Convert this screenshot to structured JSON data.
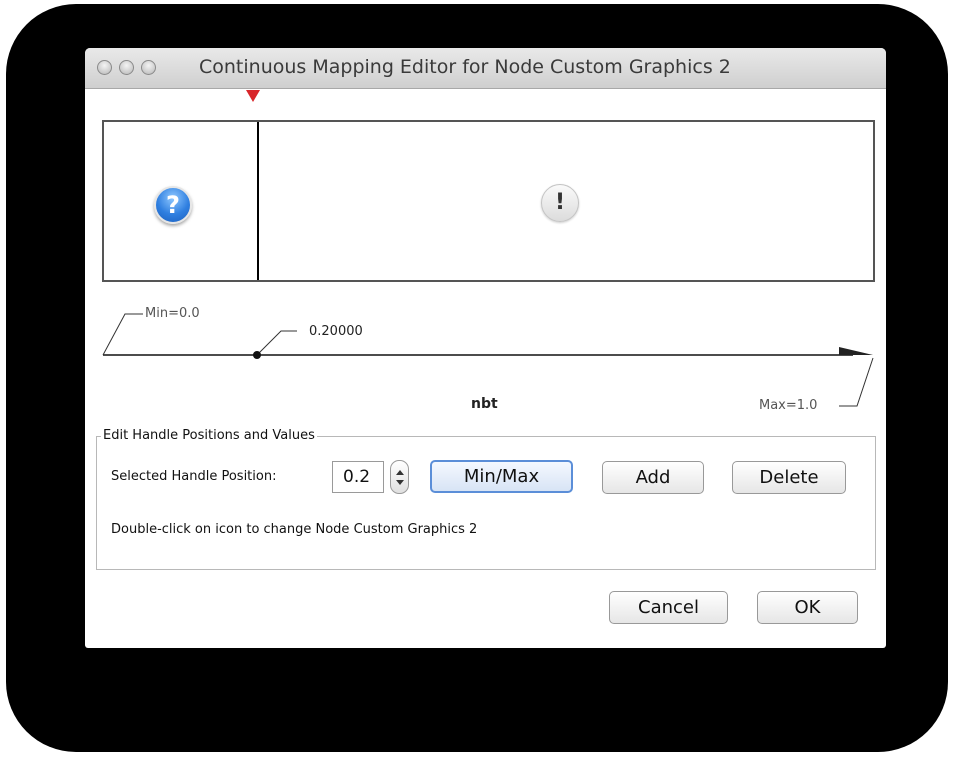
{
  "window": {
    "title": "Continuous Mapping Editor for Node Custom Graphics 2"
  },
  "preview": {
    "left_icon": "question-icon",
    "right_icon": "warning-icon"
  },
  "axis": {
    "min_label": "Min=0.0",
    "max_label": "Max=1.0",
    "handle_value_label": "0.20000",
    "attribute_name": "nbt",
    "min": 0.0,
    "max": 1.0,
    "handle_position": 0.2
  },
  "edit_panel": {
    "legend": "Edit Handle Positions and Values",
    "handle_position_label": "Selected Handle Position:",
    "handle_position_value": "0.2",
    "minmax_button": "Min/Max",
    "add_button": "Add",
    "delete_button": "Delete",
    "hint": "Double-click on icon to change Node Custom Graphics 2"
  },
  "footer": {
    "cancel_button": "Cancel",
    "ok_button": "OK"
  },
  "colors": {
    "handle_marker": "#d8262a",
    "default_button_border": "#5b8ed8"
  }
}
